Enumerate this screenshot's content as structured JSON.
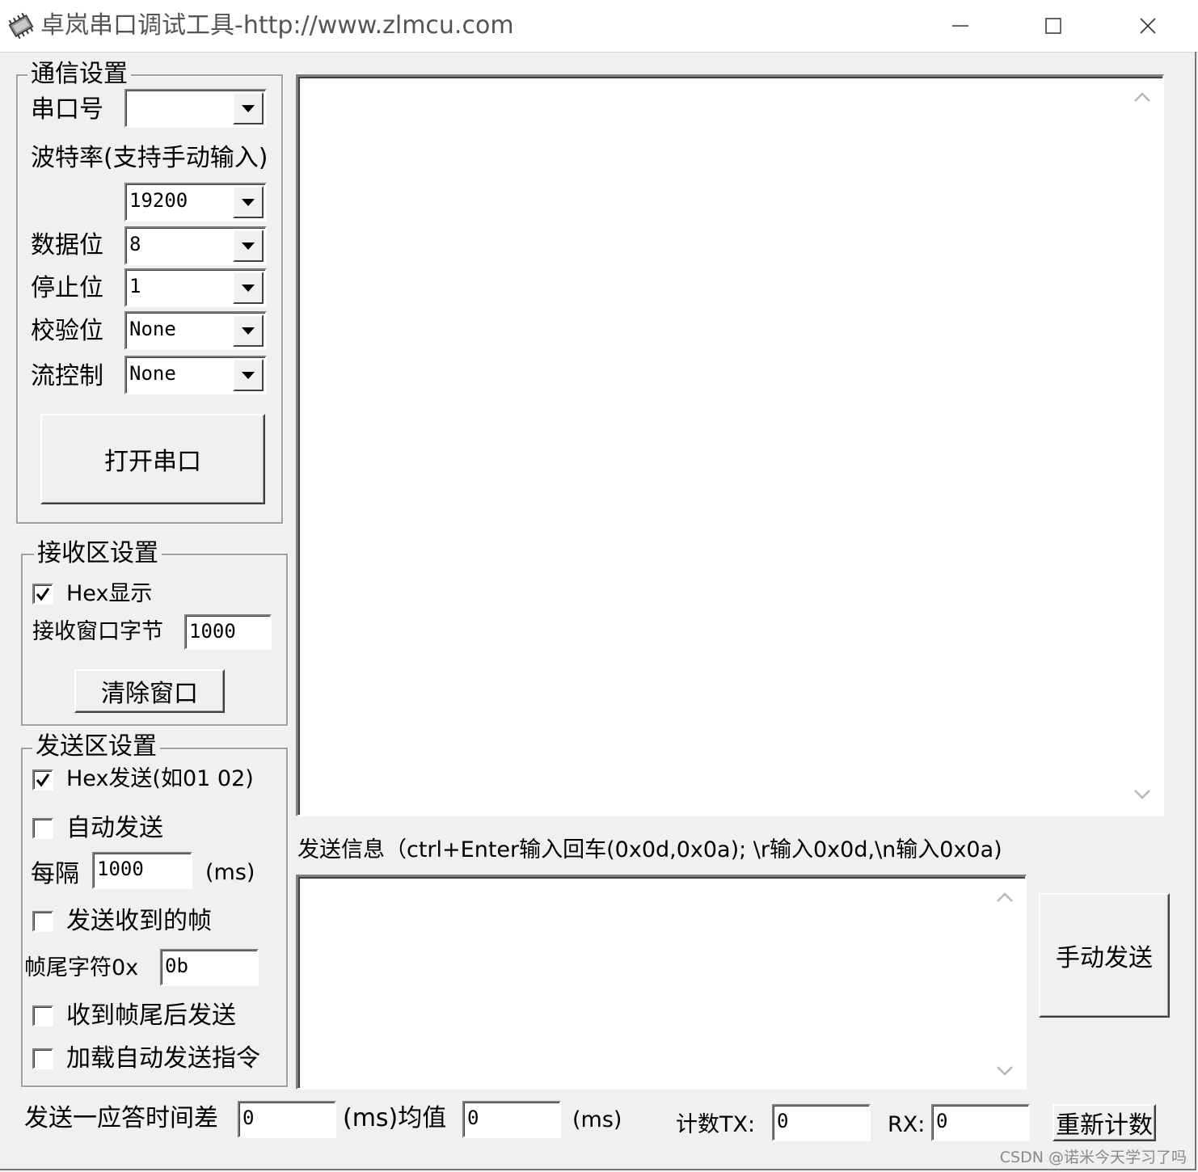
{
  "window": {
    "title": "卓岚串口调试工具-http://www.zlmcu.com",
    "icon": "app-chip-icon",
    "controls": [
      "minimize-icon",
      "maximize-icon",
      "close-icon"
    ]
  },
  "comm": {
    "legend": "通信设置",
    "port_label": "串口号",
    "port_value": "",
    "baud_label": "波特率(支持手动输入)",
    "baud_value": "19200",
    "databits_label": "数据位",
    "databits_value": "8",
    "stopbits_label": "停止位",
    "stopbits_value": "1",
    "parity_label": "校验位",
    "parity_value": "None",
    "flow_label": "流控制",
    "flow_value": "None",
    "open_button": "打开串口"
  },
  "receive": {
    "legend": "接收区设置",
    "hex_display_label": "Hex显示",
    "hex_display_checked": true,
    "window_bytes_label": "接收窗口字节",
    "window_bytes_value": "1000",
    "clear_button": "清除窗口"
  },
  "send": {
    "legend": "发送区设置",
    "hex_send_label": "Hex发送(如01 02)",
    "hex_send_checked": true,
    "auto_send_label": "自动发送",
    "auto_send_checked": false,
    "interval_label": "每隔",
    "interval_value": "1000",
    "interval_unit": "(ms)",
    "send_received_label": "发送收到的帧",
    "send_received_checked": false,
    "frame_tail_label": "帧尾字符0x",
    "frame_tail_value": "0b",
    "send_after_tail_label": "收到帧尾后发送",
    "send_after_tail_checked": false,
    "load_auto_cmd_label": "加载自动发送指令",
    "load_auto_cmd_checked": false
  },
  "main": {
    "receive_text": "",
    "send_info_label": "发送信息（ctrl+Enter输入回车(0x0d,0x0a); \\r输入0x0d,\\n输入0x0a)",
    "send_text": "",
    "manual_send_button": "手动发送"
  },
  "status": {
    "latency_label": "发送一应答时间差",
    "latency_value": "0",
    "ms_avg_label": "(ms)均值",
    "avg_value": "0",
    "ms_label": "(ms)",
    "count_tx_label": "计数TX:",
    "tx_value": "0",
    "rx_label": "RX:",
    "rx_value": "0",
    "recount_button": "重新计数"
  },
  "watermark": "CSDN @诺米今天学习了吗"
}
